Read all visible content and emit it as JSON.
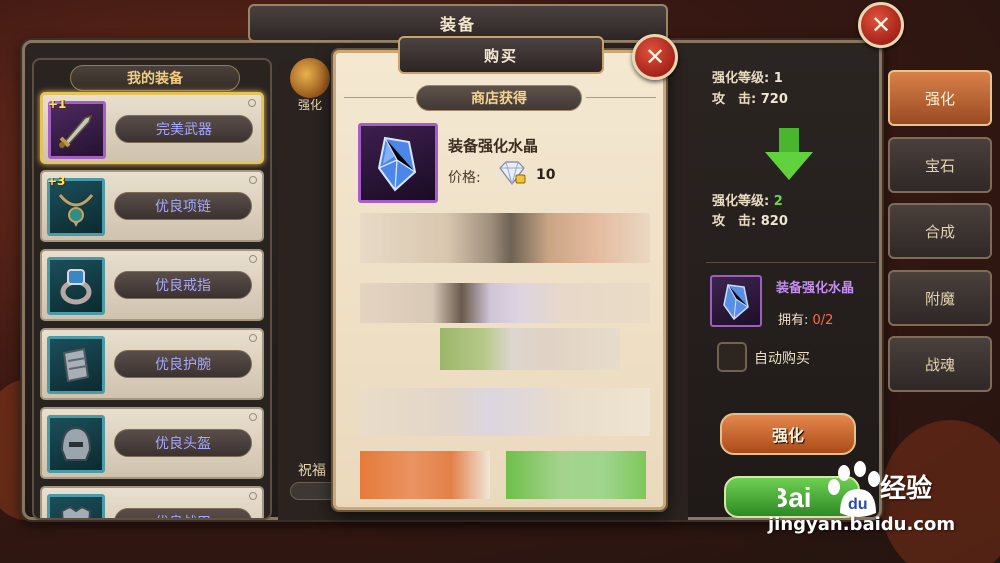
{
  "window": {
    "title": "装备"
  },
  "left_panel": {
    "header": "我的装备",
    "items": [
      {
        "name": "完美武器",
        "plus": "+1",
        "icon": "sword-icon",
        "selected": true
      },
      {
        "name": "优良项链",
        "plus": "+3",
        "icon": "necklace-icon",
        "selected": false
      },
      {
        "name": "优良戒指",
        "plus": "",
        "icon": "ring-icon",
        "selected": false
      },
      {
        "name": "优良护腕",
        "plus": "",
        "icon": "bracer-icon",
        "selected": false
      },
      {
        "name": "优良头盔",
        "plus": "",
        "icon": "helmet-icon",
        "selected": false
      },
      {
        "name": "优良战甲",
        "plus": "",
        "icon": "armor-icon",
        "selected": false
      }
    ]
  },
  "center": {
    "strengthen_label": "强化",
    "blessing_label": "祝福"
  },
  "stats": {
    "current": {
      "level_label": "强化等级:",
      "level": "1",
      "attack_label": "攻　击:",
      "attack": "720"
    },
    "next": {
      "level_label": "强化等级:",
      "level": "2",
      "attack_label": "攻　击:",
      "attack": "820"
    }
  },
  "material": {
    "name": "装备强化水晶",
    "own_label": "拥有:",
    "own_value": "0/2",
    "icon": "crystal-icon"
  },
  "auto_buy": {
    "label": "自动购买",
    "checked": false
  },
  "buttons": {
    "strengthen": "强化",
    "green_button": ""
  },
  "tabs": [
    {
      "label": "强化",
      "active": true
    },
    {
      "label": "宝石",
      "active": false
    },
    {
      "label": "合成",
      "active": false
    },
    {
      "label": "附魔",
      "active": false
    },
    {
      "label": "战魂",
      "active": false
    }
  ],
  "dialog": {
    "title": "购买",
    "sub_header": "商店获得",
    "item_name": "装备强化水晶",
    "price_label": "价格:",
    "price_value": "10",
    "currency_icon": "diamond-icon"
  },
  "watermark": {
    "brand": "经验",
    "url": "jingyan.baidu.com"
  },
  "colors": {
    "accent_orange": "#d9814a",
    "accent_green": "#6cd54a",
    "rarity_purple": "#a85cc9",
    "rarity_blue": "#a5a7ff",
    "warning_red": "#ff6a4a"
  }
}
